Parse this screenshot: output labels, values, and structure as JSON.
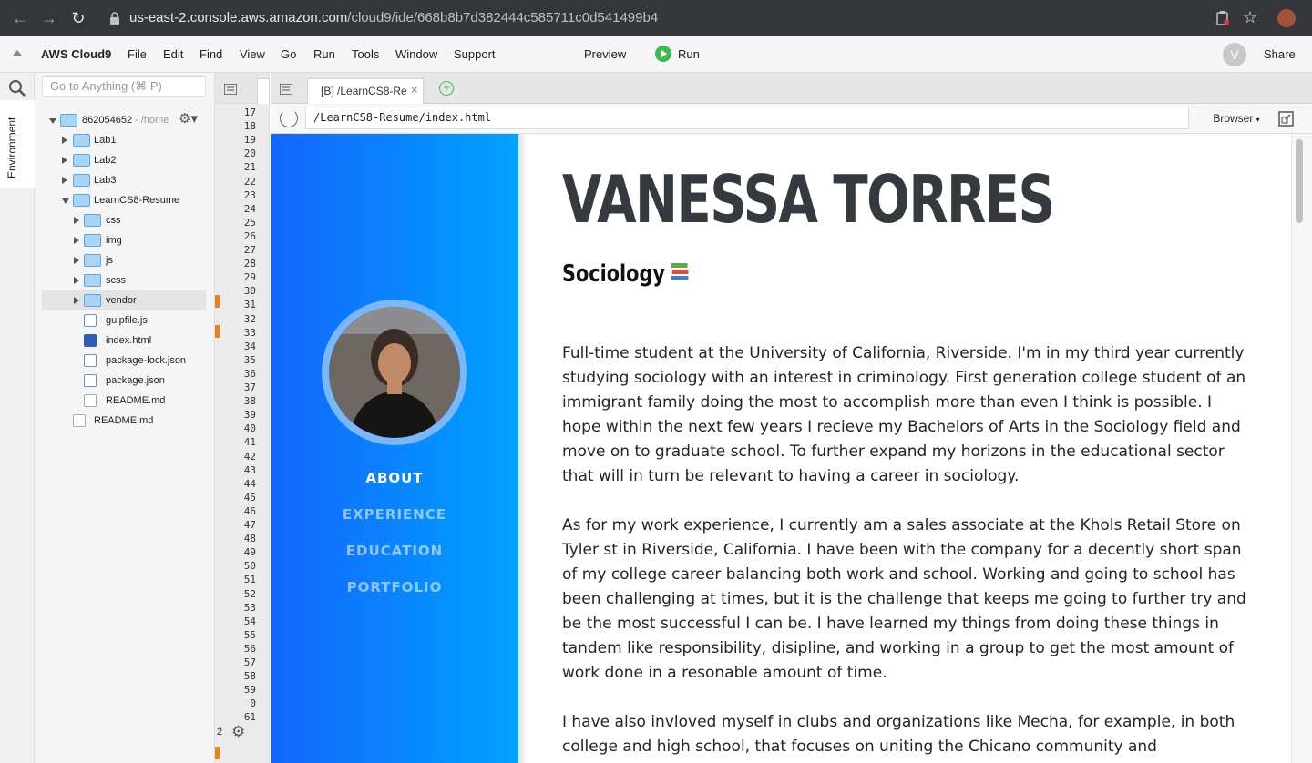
{
  "browser": {
    "url_domain": "us-east-2.console.aws.amazon.com",
    "url_path": "/cloud9/ide/668b8b7d382444c585711c0d541499b4"
  },
  "menubar": {
    "brand": "AWS Cloud9",
    "items": [
      "File",
      "Edit",
      "Find",
      "View",
      "Go",
      "Run",
      "Tools",
      "Window",
      "Support"
    ],
    "preview": "Preview",
    "run": "Run",
    "avatar": "V",
    "share": "Share"
  },
  "sidebar": {
    "env_label": "Environment",
    "goto_placeholder": "Go to Anything (⌘ P)"
  },
  "tree": {
    "root_name": "862054652",
    "root_sub": "- /home",
    "items": [
      {
        "label": "Lab1",
        "type": "folder"
      },
      {
        "label": "Lab2",
        "type": "folder"
      },
      {
        "label": "Lab3",
        "type": "folder"
      },
      {
        "label": "LearnCS8-Resume",
        "type": "folder"
      },
      {
        "label": "css",
        "type": "folder"
      },
      {
        "label": "img",
        "type": "folder"
      },
      {
        "label": "js",
        "type": "folder"
      },
      {
        "label": "scss",
        "type": "folder"
      },
      {
        "label": "vendor",
        "type": "folder"
      },
      {
        "label": "gulpfile.js",
        "type": "file"
      },
      {
        "label": "index.html",
        "type": "file"
      },
      {
        "label": "package-lock.json",
        "type": "file"
      },
      {
        "label": "package.json",
        "type": "file"
      },
      {
        "label": "README.md",
        "type": "file"
      },
      {
        "label": "README.md",
        "type": "file"
      }
    ]
  },
  "gutter": {
    "lines": [
      "17",
      "18",
      "19",
      "20",
      "21",
      "22",
      "23",
      "24",
      "25",
      "26",
      "27",
      "28",
      "29",
      "30",
      "31",
      "32",
      "33",
      "34",
      "35",
      "36",
      "37",
      "38",
      "39",
      "40",
      "41",
      "42",
      "43",
      "44",
      "45",
      "46",
      "47",
      "48",
      "49",
      "50",
      "51",
      "52",
      "53",
      "54",
      "55",
      "56",
      "57",
      "58",
      "59",
      "0",
      "61"
    ],
    "bottom_count": "2"
  },
  "preview": {
    "tab_label": "[B] /LearnCS8-Re",
    "address": "/LearnCS8-Resume/index.html",
    "browser_select": "Browser"
  },
  "resume": {
    "name": "VANESSA TORRES",
    "subtitle": "Sociology",
    "nav": [
      "ABOUT",
      "EXPERIENCE",
      "EDUCATION",
      "PORTFOLIO"
    ],
    "paragraphs": [
      "Full-time student at the University of California, Riverside. I'm in my third year currently studying sociology with an interest in criminology. First generation college student of an immigrant family doing the most to accomplish more than even I think is possible. I hope within the next few years I recieve my Bachelors of Arts in the Sociology field and move on to graduate school. To further expand my horizons in the educational sector that will in turn be relevant to having a career in sociology.",
      "As for my work experience, I currently am a sales associate at the Khols Retail Store on Tyler st in Riverside, California. I have been with the company for a decently short span of my college career balancing both work and school. Working and going to school has been challenging at times, but it is the challenge that keeps me going to further try and be the most successful I can be. I have learned my things from doing these things in tandem like responsibility, disipline, and working in a group to get the most amount of work done in a resonable amount of time.",
      "I have also invloved myself in clubs and organizations like Mecha, for example, in both college and high school, that focuses on uniting the Chicano community and"
    ]
  },
  "colors": {
    "sidebar_gradient_start": "#1366fd",
    "sidebar_gradient_end": "#00a2ff",
    "run_green": "#3fb950",
    "modified_marker": "#f0801a"
  }
}
